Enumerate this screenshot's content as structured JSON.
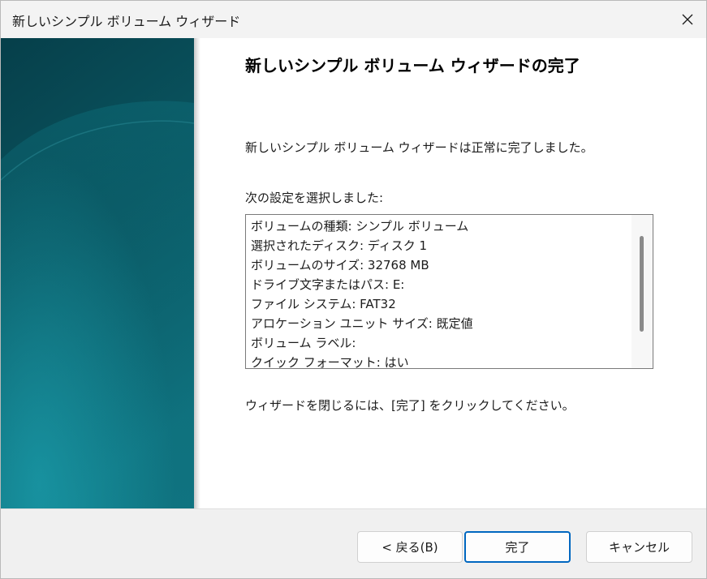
{
  "window": {
    "title": "新しいシンプル ボリューム ウィザード"
  },
  "icons": {
    "close": "close-icon"
  },
  "page": {
    "heading": "新しいシンプル ボリューム ウィザードの完了",
    "success_text": "新しいシンプル ボリューム ウィザードは正常に完了しました。",
    "settings_label": "次の設定を選択しました:",
    "settings": [
      "ボリュームの種類: シンプル ボリューム",
      "選択されたディスク: ディスク 1",
      "ボリュームのサイズ: 32768 MB",
      "ドライブ文字またはパス: E:",
      "ファイル システム: FAT32",
      "アロケーション ユニット サイズ: 既定値",
      "ボリューム ラベル:",
      "クイック フォーマット: はい"
    ],
    "close_hint": "ウィザードを閉じるには、[完了] をクリックしてください。"
  },
  "buttons": {
    "back": "< 戻る(B)",
    "finish": "完了",
    "cancel": "キャンセル"
  },
  "colors": {
    "accent": "#0067c0",
    "side_art_dark": "#053c47",
    "side_art_light": "#127f8e"
  }
}
